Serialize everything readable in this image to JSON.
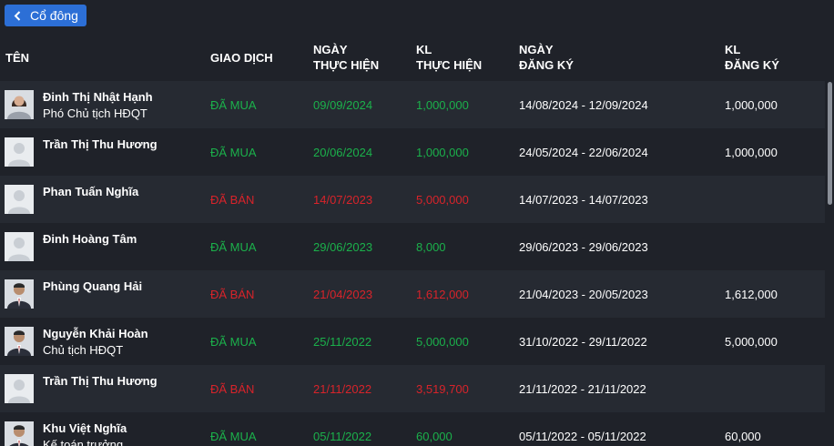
{
  "back_button": {
    "label": "Cổ đông",
    "icon": "chevron-left-icon"
  },
  "columns": {
    "name": "TÊN",
    "transaction": "GIAO DỊCH",
    "exec_date": [
      "NGÀY",
      "THỰC HIỆN"
    ],
    "exec_volume": [
      "KL",
      "THỰC HIỆN"
    ],
    "reg_date": [
      "NGÀY",
      "ĐĂNG KÝ"
    ],
    "reg_volume": [
      "KL",
      "ĐĂNG KÝ"
    ]
  },
  "colors": {
    "buy": "#1bb14b",
    "sell": "#d8232a",
    "accent": "#2c6fd6",
    "background": "#1f2229",
    "row_alt": "#262a32"
  },
  "rows": [
    {
      "name": "Đinh Thị Nhật Hạnh",
      "title": "Phó Chủ tịch HĐQT",
      "avatar": "photo-woman",
      "type": "ĐÃ MUA",
      "kind": "buy",
      "exec_date": "09/09/2024",
      "exec_volume": "1,000,000",
      "reg_range": "14/08/2024 - 12/09/2024",
      "reg_volume": "1,000,000"
    },
    {
      "name": "Trần Thị Thu Hương",
      "title": "",
      "avatar": "placeholder",
      "type": "ĐÃ MUA",
      "kind": "buy",
      "exec_date": "20/06/2024",
      "exec_volume": "1,000,000",
      "reg_range": "24/05/2024 - 22/06/2024",
      "reg_volume": "1,000,000"
    },
    {
      "name": "Phan Tuấn Nghĩa",
      "title": "",
      "avatar": "placeholder",
      "type": "ĐÃ BÁN",
      "kind": "sell",
      "exec_date": "14/07/2023",
      "exec_volume": "5,000,000",
      "reg_range": "14/07/2023 - 14/07/2023",
      "reg_volume": ""
    },
    {
      "name": "Đinh Hoàng Tâm",
      "title": "",
      "avatar": "placeholder",
      "type": "ĐÃ MUA",
      "kind": "buy",
      "exec_date": "29/06/2023",
      "exec_volume": "8,000",
      "reg_range": "29/06/2023 - 29/06/2023",
      "reg_volume": ""
    },
    {
      "name": "Phùng Quang Hải",
      "title": "",
      "avatar": "photo-man",
      "type": "ĐÃ BÁN",
      "kind": "sell",
      "exec_date": "21/04/2023",
      "exec_volume": "1,612,000",
      "reg_range": "21/04/2023 - 20/05/2023",
      "reg_volume": "1,612,000"
    },
    {
      "name": "Nguyễn Khải Hoàn",
      "title": "Chủ tịch HĐQT",
      "avatar": "photo-man",
      "type": "ĐÃ MUA",
      "kind": "buy",
      "exec_date": "25/11/2022",
      "exec_volume": "5,000,000",
      "reg_range": "31/10/2022 - 29/11/2022",
      "reg_volume": "5,000,000"
    },
    {
      "name": "Trần Thị Thu Hương",
      "title": "",
      "avatar": "placeholder",
      "type": "ĐÃ BÁN",
      "kind": "sell",
      "exec_date": "21/11/2022",
      "exec_volume": "3,519,700",
      "reg_range": "21/11/2022 - 21/11/2022",
      "reg_volume": ""
    },
    {
      "name": "Khu Việt Nghĩa",
      "title": "Kế toán trưởng",
      "avatar": "photo-man",
      "type": "ĐÃ MUA",
      "kind": "buy",
      "exec_date": "05/11/2022",
      "exec_volume": "60,000",
      "reg_range": "05/11/2022 - 05/11/2022",
      "reg_volume": "60,000"
    }
  ]
}
